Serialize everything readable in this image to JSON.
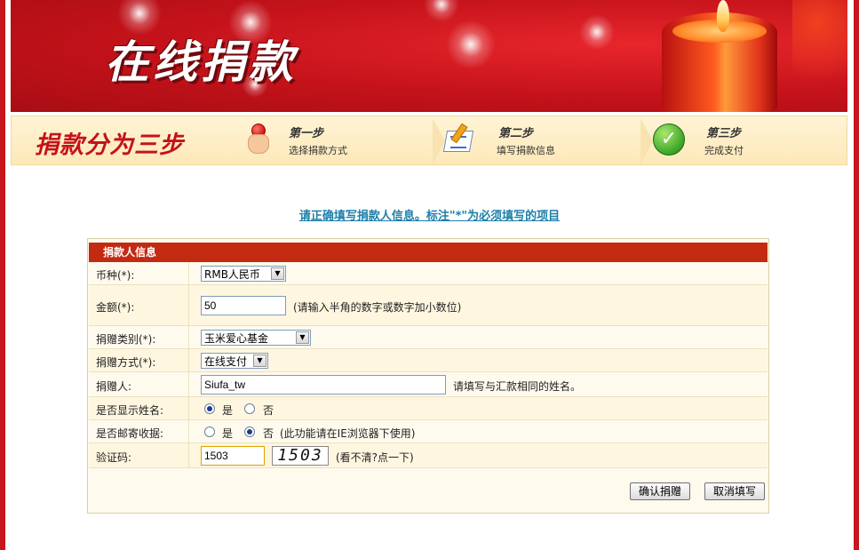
{
  "banner": {
    "title": "在线捐款"
  },
  "steps": {
    "title": "捐款分为三步",
    "items": [
      {
        "label": "第一步",
        "desc": "选择捐款方式",
        "icon": "hand-pointer-icon"
      },
      {
        "label": "第二步",
        "desc": "填写捐款信息",
        "icon": "notepad-icon"
      },
      {
        "label": "第三步",
        "desc": "完成支付",
        "icon": "checkmark-icon"
      }
    ]
  },
  "instruction": "请正确填写捐款人信息。标注\"*\"为必须填写的项目",
  "form": {
    "header": "捐款人信息",
    "currency": {
      "label": "币种(*):",
      "value": "RMB人民币"
    },
    "amount": {
      "label": "金额(*):",
      "value": "50",
      "hint": "(请输入半角的数字或数字加小数位)"
    },
    "category": {
      "label": "捐赠类别(*):",
      "value": "玉米爱心基金"
    },
    "method": {
      "label": "捐赠方式(*):",
      "value": "在线支付"
    },
    "donor": {
      "label": "捐赠人:",
      "value": "Siufa_tw",
      "hint": "请填写与汇款相同的姓名。"
    },
    "show_name": {
      "label": "是否显示姓名:",
      "yes": "是",
      "no": "否",
      "selected": "yes"
    },
    "mail_receipt": {
      "label": "是否邮寄收据:",
      "yes": "是",
      "no": "否",
      "selected": "no",
      "note": "(此功能请在IE浏览器下使用)"
    },
    "captcha": {
      "label": "验证码:",
      "value": "1503",
      "image_text": "1503",
      "hint": "(看不清?点一下)"
    },
    "buttons": {
      "confirm": "确认捐赠",
      "cancel": "取消填写"
    }
  },
  "colors": {
    "brand_red": "#c4121a",
    "header_red": "#c42a12",
    "link_blue": "#1d7fa8",
    "panel_bg": "#fffaee"
  }
}
